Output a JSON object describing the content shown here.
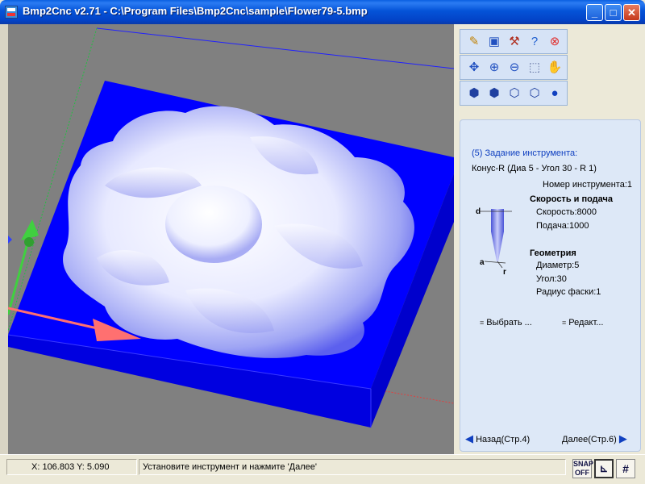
{
  "window": {
    "title": "Bmp2Cnc v2.71 - C:\\Program Files\\Bmp2Cnc\\sample\\Flower79-5.bmp",
    "minimize": "_",
    "maximize": "□",
    "close": "✕"
  },
  "toolbar": {
    "rows": [
      [
        "open-icon",
        "save-icon",
        "hammer-icon",
        "help-icon",
        "exit-icon"
      ],
      [
        "center-icon",
        "zoom-in-icon",
        "zoom-out-icon",
        "zoom-window-icon",
        "pan-hand-icon"
      ],
      [
        "view-iso-icon",
        "view-front-icon",
        "view-side-icon",
        "view-top-icon",
        "sphere-icon"
      ]
    ]
  },
  "tool_setup": {
    "heading": "(5) Задание инструмента:",
    "tool_name": "Конус-R (Диа 5 - Угол 30 - R 1)",
    "tool_number": "Номер инструмента:1",
    "speed_heading": "Скорость и подача",
    "speed": "Скорость:8000",
    "feed": "Подача:1000",
    "geometry_heading": "Геометрия",
    "diameter": "Диаметр:5",
    "angle": "Угол:30",
    "chamfer_radius": "Радиус фаски:1",
    "diagram_labels": {
      "d": "d",
      "a": "a",
      "r": "r"
    },
    "select_button": "Выбрать ...",
    "edit_button": "Редакт..."
  },
  "navigation": {
    "back": "Назад(Стр.4)",
    "next": "Далее(Стр.6)"
  },
  "status": {
    "coords": "X: 106.803 Y:  5.090",
    "message": "Установите инструмент и нажмите 'Далее'",
    "snap": "SNAP\nOFF"
  },
  "colors": {
    "block": "#0000ff",
    "background": "#808080",
    "x_axis": "#ff7070",
    "y_axis": "#40d040"
  }
}
